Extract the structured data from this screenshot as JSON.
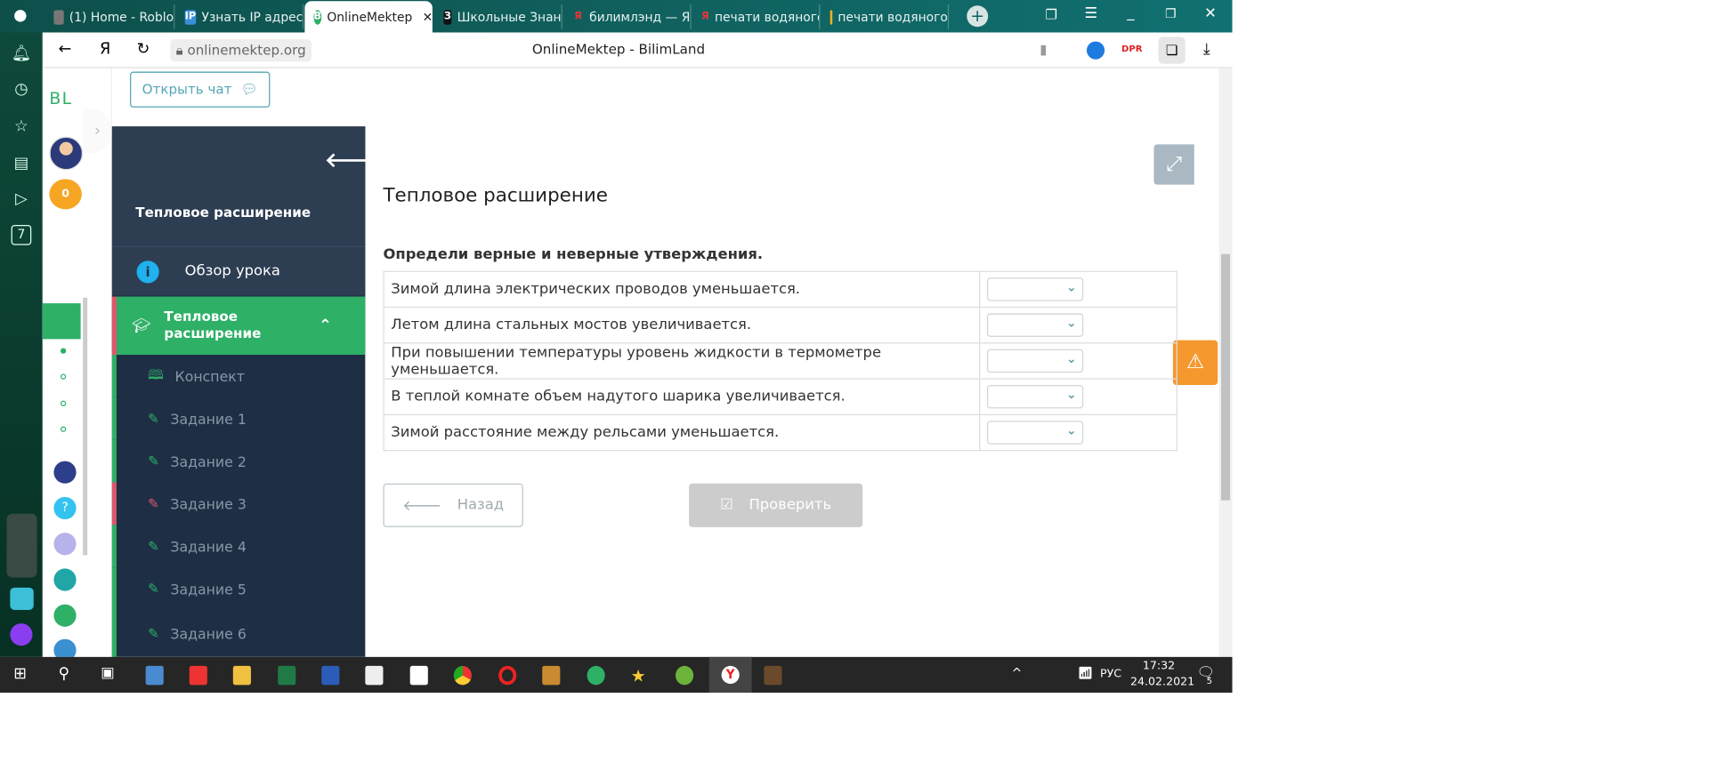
{
  "browser": {
    "tabs": [
      {
        "label": "(1) Home - Roblo",
        "icon": "roblox"
      },
      {
        "label": "Узнать IP адрес",
        "icon": "ip"
      },
      {
        "label": "OnlineMektep",
        "icon": "onlinemektep",
        "active": true
      },
      {
        "label": "Школьные Знан",
        "icon": "znaniya"
      },
      {
        "label": "билимлэнд — Я",
        "icon": "yandex"
      },
      {
        "label": "печати водяного",
        "icon": "yandex"
      },
      {
        "label": "печати водяного",
        "icon": "image"
      }
    ],
    "url": "onlinemektep.org",
    "page_title": "OnlineMektep - BilimLand"
  },
  "side": {
    "logo": "BL",
    "coins": "0",
    "dock_badge": "7"
  },
  "chat_button": "Открыть чат",
  "lesson": {
    "title": "Тепловое расширение",
    "overview": "Обзор урока",
    "section": "Тепловое расширение",
    "items": [
      {
        "label": "Конспект",
        "type": "book",
        "color": "#2eb067"
      },
      {
        "label": "Задание 1",
        "color": "#2eb067"
      },
      {
        "label": "Задание 2",
        "color": "#2eb067"
      },
      {
        "label": "Задание 3",
        "color": "#e0566a"
      },
      {
        "label": "Задание 4",
        "color": "#2eb067"
      },
      {
        "label": "Задание 5",
        "color": "#2eb067"
      },
      {
        "label": "Задание 6",
        "color": "#2eb067"
      }
    ]
  },
  "task": {
    "title": "Тепловое расширение",
    "instruction": "Определи верные и неверные утверждения.",
    "rows": [
      {
        "statement": "Зимой длина электрических проводов уменьшается.",
        "answer": ""
      },
      {
        "statement": "Летом длина стальных мостов увеличивается.",
        "answer": ""
      },
      {
        "statement": "При повышении температуры уровень жидкости в термометре уменьшается.",
        "answer": ""
      },
      {
        "statement": "В теплой комнате объем надутого шарика увеличивается.",
        "answer": ""
      },
      {
        "statement": "Зимой расстояние между рельсами уменьшается.",
        "answer": ""
      }
    ],
    "back": "Назад",
    "check": "Проверить"
  },
  "taskbar": {
    "lang": "РУС",
    "time": "17:32",
    "date": "24.02.2021",
    "notifications": "5"
  }
}
